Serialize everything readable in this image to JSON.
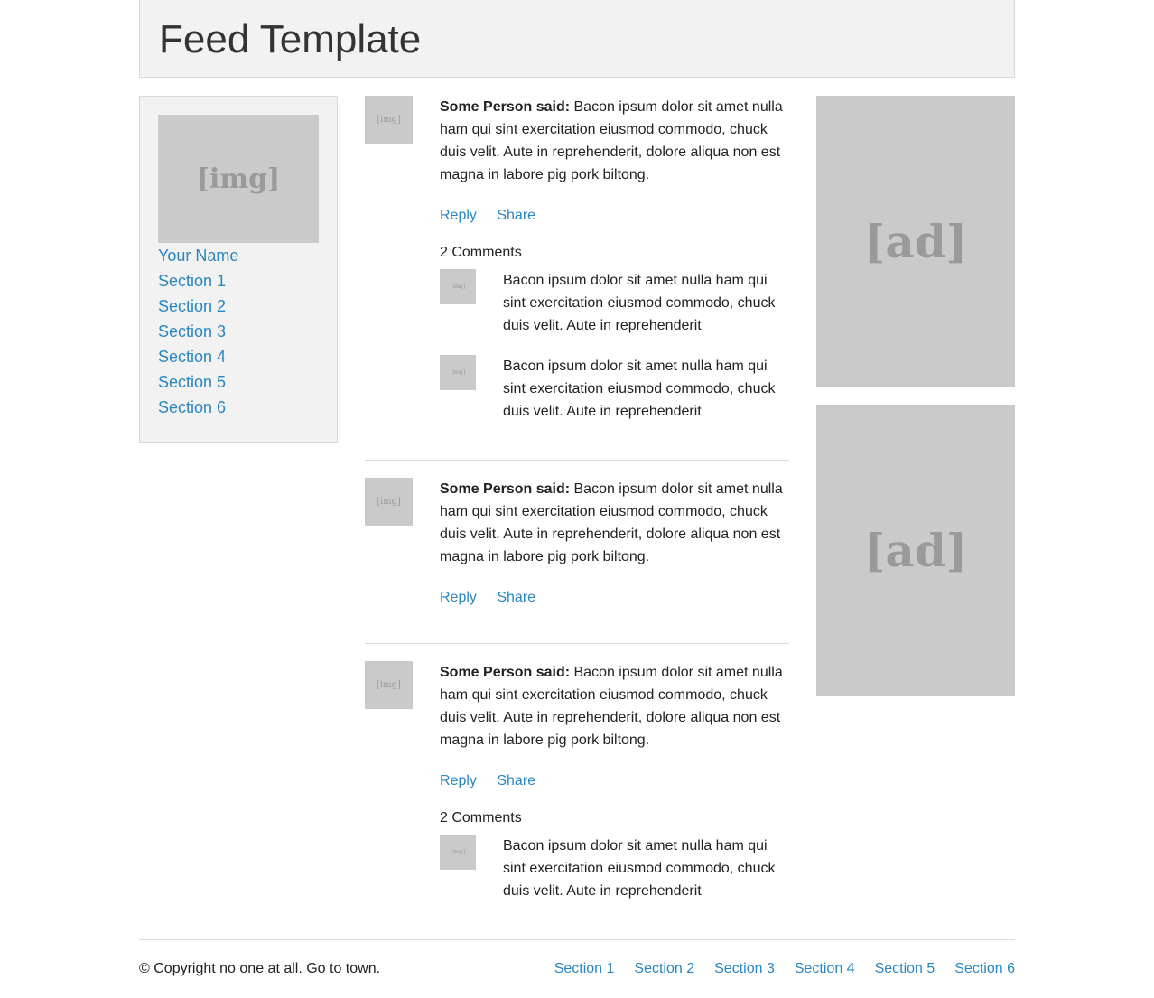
{
  "header": {
    "title": "Feed Template"
  },
  "sidebar": {
    "image_placeholder": "[img]",
    "items": [
      {
        "label": "Your Name"
      },
      {
        "label": "Section 1"
      },
      {
        "label": "Section 2"
      },
      {
        "label": "Section 3"
      },
      {
        "label": "Section 4"
      },
      {
        "label": "Section 5"
      },
      {
        "label": "Section 6"
      }
    ]
  },
  "feed": {
    "posts": [
      {
        "avatar": "[img]",
        "author": "Some Person said:",
        "text": " Bacon ipsum dolor sit amet nulla ham qui sint exercitation eiusmod commodo, chuck duis velit. Aute in reprehenderit, dolore aliqua non est magna in labore pig pork biltong.",
        "reply": "Reply",
        "share": "Share",
        "comments_count": "2 Comments",
        "comments": [
          {
            "avatar": "[img]",
            "text": "Bacon ipsum dolor sit amet nulla ham qui sint exercitation eiusmod commodo, chuck duis velit. Aute in reprehenderit"
          },
          {
            "avatar": "[img]",
            "text": "Bacon ipsum dolor sit amet nulla ham qui sint exercitation eiusmod commodo, chuck duis velit. Aute in reprehenderit"
          }
        ]
      },
      {
        "avatar": "[img]",
        "author": "Some Person said:",
        "text": " Bacon ipsum dolor sit amet nulla ham qui sint exercitation eiusmod commodo, chuck duis velit. Aute in reprehenderit, dolore aliqua non est magna in labore pig pork biltong.",
        "reply": "Reply",
        "share": "Share"
      },
      {
        "avatar": "[img]",
        "author": "Some Person said:",
        "text": " Bacon ipsum dolor sit amet nulla ham qui sint exercitation eiusmod commodo, chuck duis velit. Aute in reprehenderit, dolore aliqua non est magna in labore pig pork biltong.",
        "reply": "Reply",
        "share": "Share",
        "comments_count": "2 Comments",
        "comments": [
          {
            "avatar": "[img]",
            "text": "Bacon ipsum dolor sit amet nulla ham qui sint exercitation eiusmod commodo, chuck duis velit. Aute in reprehenderit"
          }
        ]
      }
    ]
  },
  "ads": [
    {
      "label": "[ad]"
    },
    {
      "label": "[ad]"
    }
  ],
  "footer": {
    "copyright": "© Copyright no one at all. Go to town.",
    "nav": [
      "Section 1",
      "Section 2",
      "Section 3",
      "Section 4",
      "Section 5",
      "Section 6"
    ]
  },
  "colors": {
    "link": "#2a86c1",
    "placeholder": "#cacaca",
    "panel": "#f2f2f2"
  }
}
